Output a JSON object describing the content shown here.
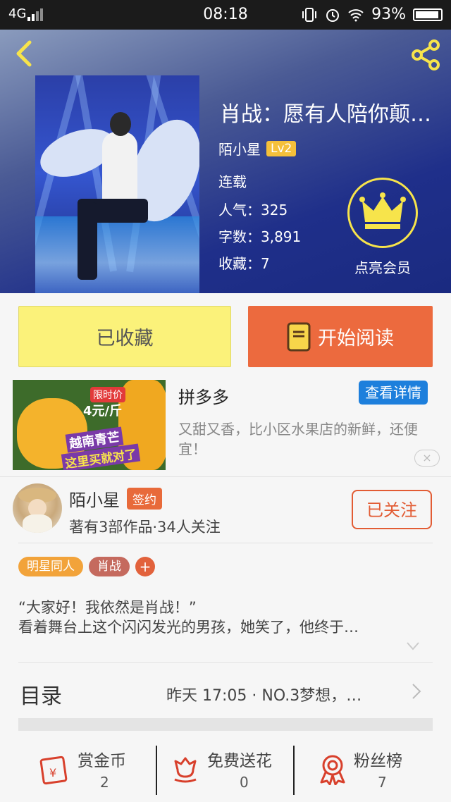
{
  "status": {
    "network": "4G",
    "time": "08:18",
    "battery": "93%",
    "battery_level": 0.93
  },
  "book": {
    "title": "肖战：愿有人陪你颠…",
    "author": "陌小星",
    "author_level": "Lv2",
    "status": "连载",
    "popularity": "人气：325",
    "word_count": "字数：3,891",
    "favorites": "收藏：7",
    "vip_label": "点亮会员"
  },
  "actions": {
    "favorited": "已收藏",
    "start_reading": "开始阅读"
  },
  "ad": {
    "title": "拼多多",
    "detail_button": "查看详情",
    "description": "又甜又香，比小区水果店的新鲜，还便宜！",
    "image_price": "4元/斤",
    "image_tag": "限时价",
    "image_text1": "越南青芒",
    "image_text2": "这里买就对了",
    "close": "×"
  },
  "author_card": {
    "name": "陌小星",
    "badge": "签约",
    "info": "著有3部作品·34人关注",
    "follow_button": "已关注"
  },
  "tags": [
    {
      "label": "明星同人",
      "color": "#f2a33a"
    },
    {
      "label": "肖战",
      "color": "#c56a5e"
    },
    {
      "label": "+",
      "color": "#e2623c"
    }
  ],
  "intro": {
    "line1": "“大家好！我依然是肖战！”",
    "line2": "看着舞台上这个闪闪发光的男孩，她笑了，他终于…"
  },
  "toc": {
    "label": "目录",
    "latest": "昨天 17:05 · NO.3梦想，…"
  },
  "bottom": [
    {
      "label": "赏金币",
      "value": "2",
      "icon": "red-envelope-icon"
    },
    {
      "label": "免费送花",
      "value": "0",
      "icon": "flower-icon"
    },
    {
      "label": "粉丝榜",
      "value": "7",
      "icon": "medal-icon"
    }
  ],
  "colors": {
    "accent": "#ec6a3e",
    "favorite_bg": "#fbf27a",
    "ad_button": "#1d7fdc",
    "vip_gold": "#f7e44b"
  }
}
